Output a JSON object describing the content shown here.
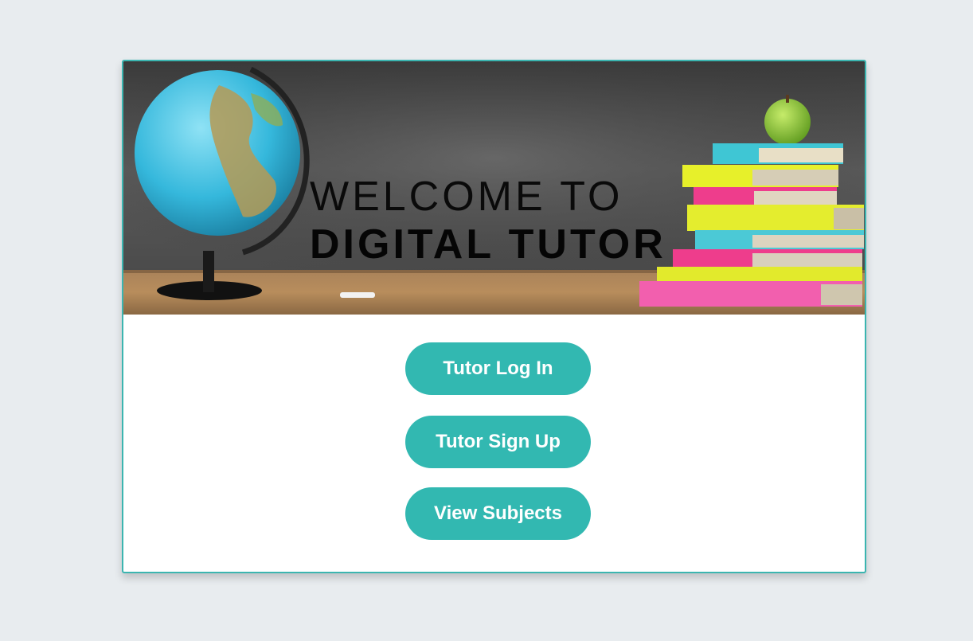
{
  "hero": {
    "line1": "WELCOME TO",
    "line2": "DIGITAL TUTOR",
    "image_description_icon": "classroom-hero-image"
  },
  "actions": {
    "login_label": "Tutor Log In",
    "signup_label": "Tutor Sign Up",
    "subjects_label": "View Subjects"
  },
  "colors": {
    "accent": "#32b8b1",
    "border": "#3bb5b0",
    "page_background": "#e8ecef"
  }
}
